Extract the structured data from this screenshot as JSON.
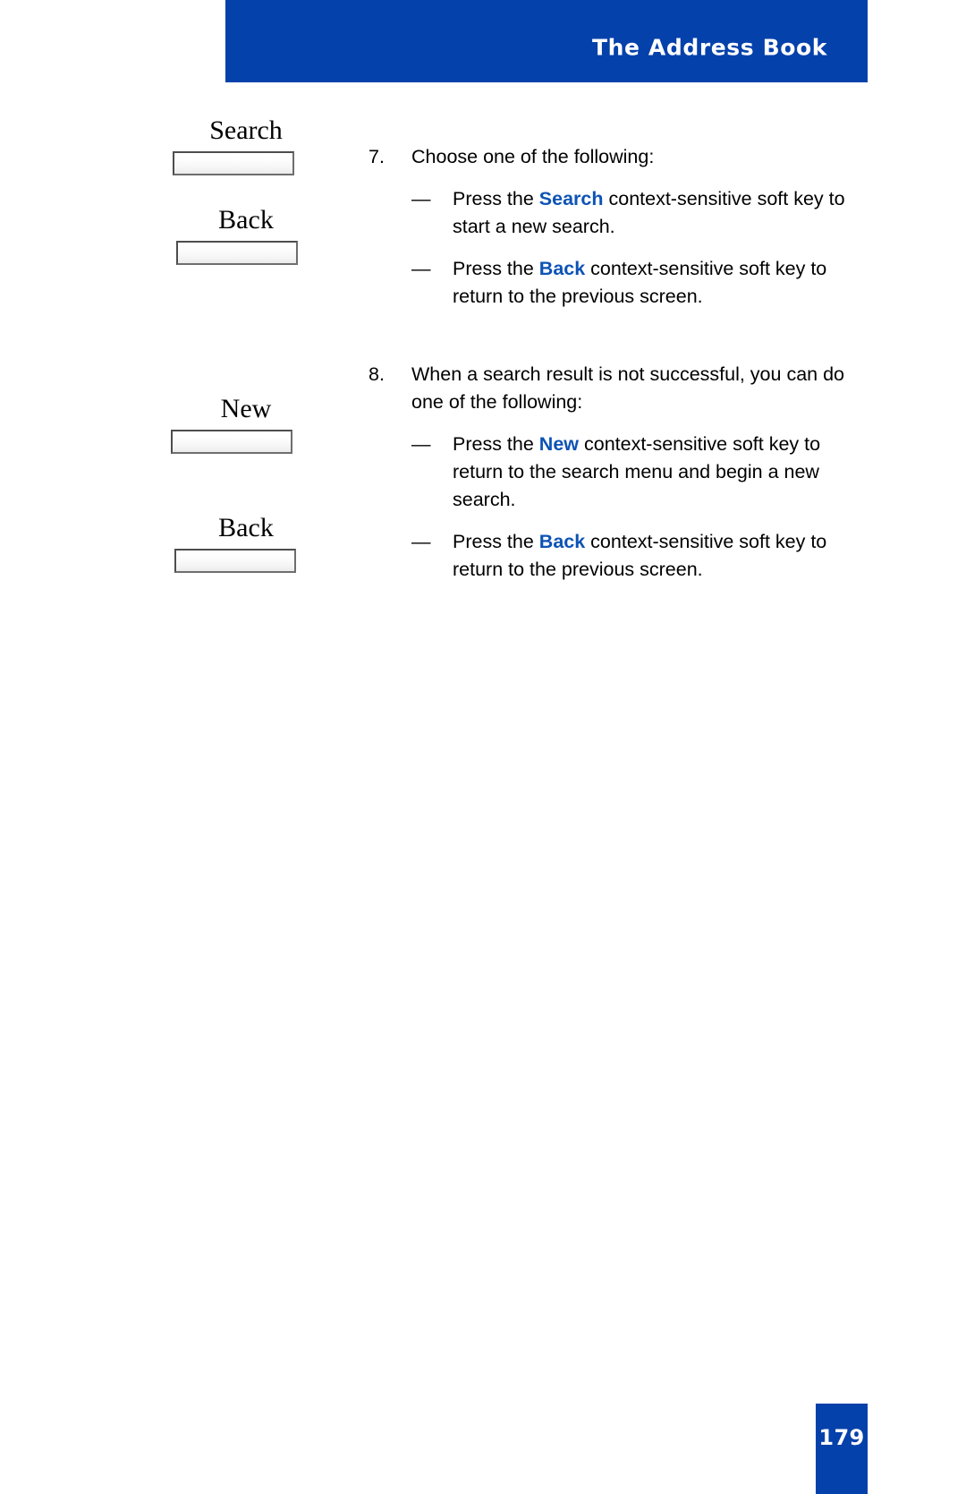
{
  "page": {
    "title": "The Address Book",
    "number": "179",
    "header_bg": "#0541ab",
    "accent_blue": "#0d53b5",
    "text_color": "#000000"
  },
  "softkeys": [
    {
      "label": "Search",
      "name": "softkey-search"
    },
    {
      "label": "Back",
      "name": "softkey-back-1"
    },
    {
      "label": "New",
      "name": "softkey-new"
    },
    {
      "label": "Back",
      "name": "softkey-back-2"
    }
  ],
  "steps": [
    {
      "number": "7.",
      "text": "Choose one of the following:",
      "bullets": [
        {
          "dash": "—",
          "pre": "Press the ",
          "keyword": "Search",
          "post": " context-sensitive soft key to start a new search."
        },
        {
          "dash": "—",
          "pre": "Press the ",
          "keyword": "Back",
          "post": " context-sensitive soft key to return to the previous screen."
        }
      ]
    },
    {
      "number": "8.",
      "text": "When a search result is not successful, you can do one of the following:",
      "bullets": [
        {
          "dash": "—",
          "pre": "Press the ",
          "keyword": "New",
          "post": " context-sensitive soft key to return to the search menu and begin a new search."
        },
        {
          "dash": "—",
          "pre": "Press the ",
          "keyword": "Back",
          "post": " context-sensitive soft key to return to the previous screen."
        }
      ]
    }
  ]
}
